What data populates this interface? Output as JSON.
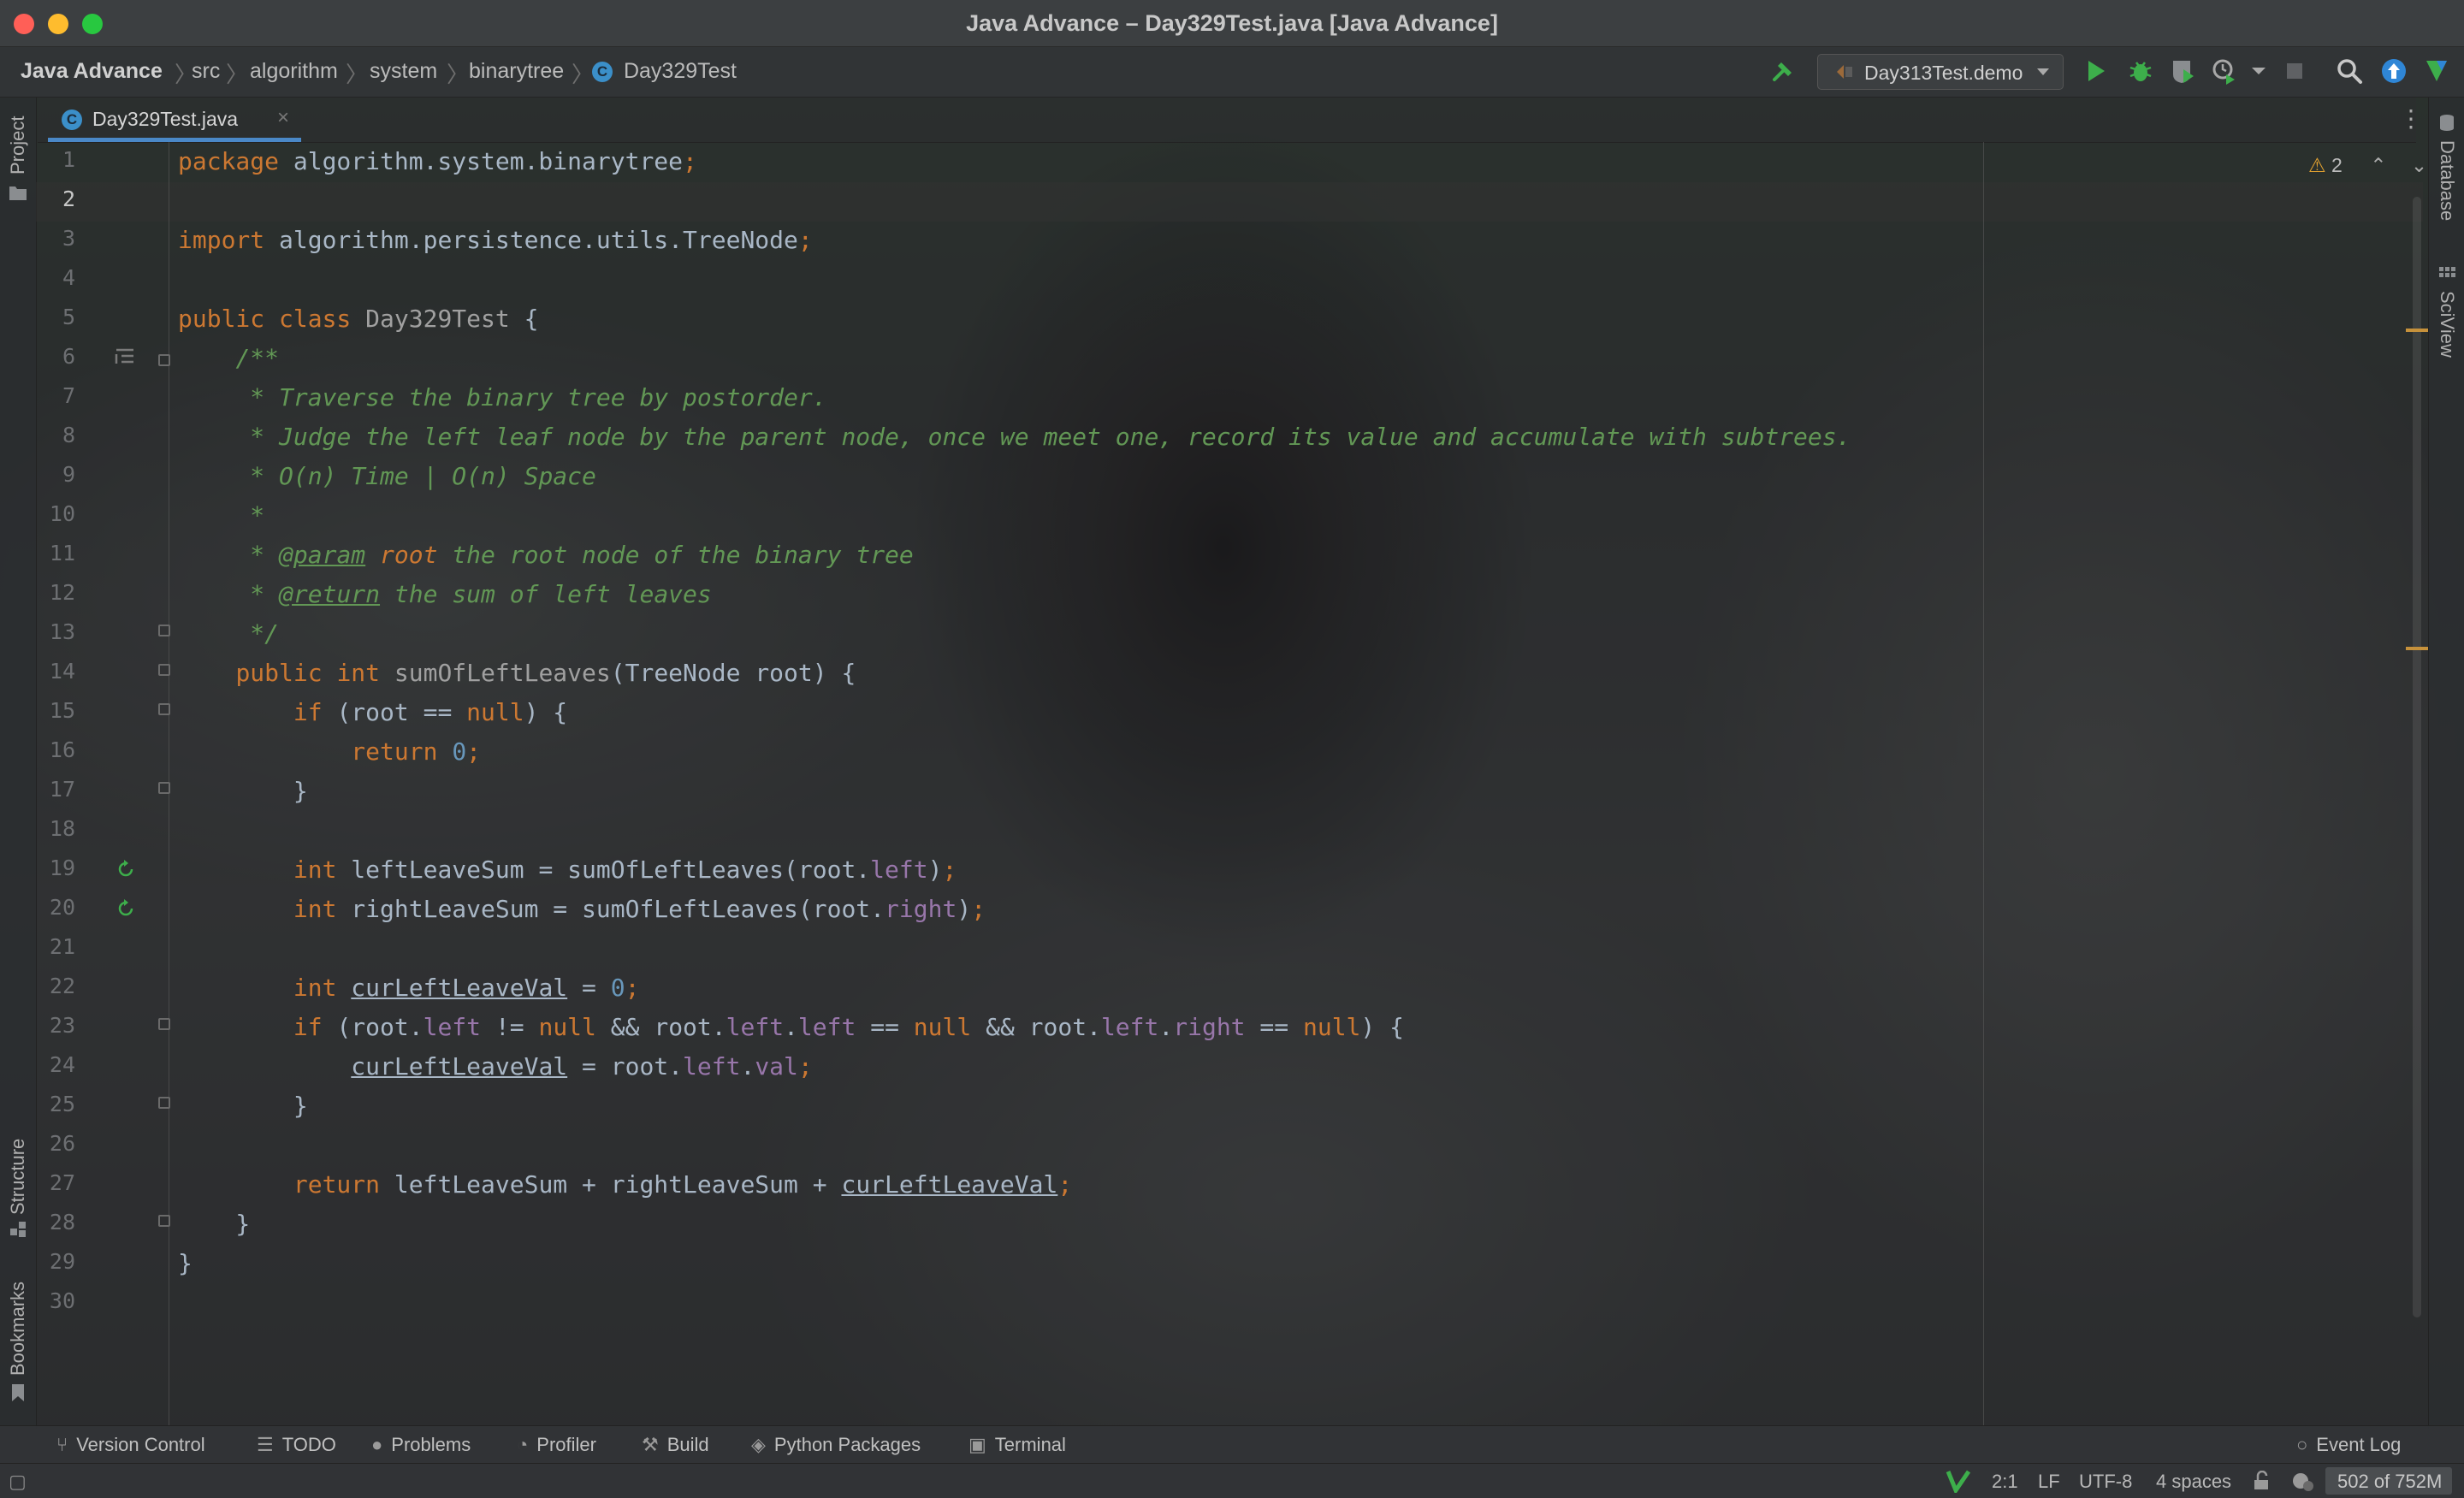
{
  "window": {
    "title": "Java Advance – Day329Test.java [Java Advance]"
  },
  "breadcrumb": {
    "project": "Java Advance",
    "items": [
      "src",
      "algorithm",
      "system",
      "binarytree"
    ],
    "class_icon": "C",
    "class_name": "Day329Test"
  },
  "toolbar": {
    "run_config": "Day313Test.demo",
    "icons": [
      "build-hammer-icon",
      "run-icon",
      "debug-icon",
      "coverage-icon",
      "profile-icon",
      "stop-icon",
      "search-icon",
      "update-icon",
      "plugin-icon"
    ]
  },
  "tabs": [
    {
      "label": "Day329Test.java",
      "icon": "C",
      "active": true
    }
  ],
  "left_strip": {
    "project": "Project",
    "structure": "Structure",
    "bookmarks": "Bookmarks"
  },
  "right_strip": {
    "database": "Database",
    "sciview": "SciView"
  },
  "editor": {
    "warnings_count": "2",
    "current_line": 2,
    "line_numbers": [
      "1",
      "2",
      "3",
      "4",
      "5",
      "6",
      "7",
      "8",
      "9",
      "10",
      "11",
      "12",
      "13",
      "14",
      "15",
      "16",
      "17",
      "18",
      "19",
      "20",
      "21",
      "22",
      "23",
      "24",
      "25",
      "26",
      "27",
      "28",
      "29",
      "30"
    ]
  },
  "bottom_tools": {
    "version_control": "Version Control",
    "todo": "TODO",
    "problems": "Problems",
    "profiler": "Profiler",
    "build": "Build",
    "python_packages": "Python Packages",
    "terminal": "Terminal",
    "event_log": "Event Log"
  },
  "status": {
    "position": "2:1",
    "line_sep": "LF",
    "encoding": "UTF-8",
    "indent": "4 spaces",
    "memory": "502 of 752M"
  },
  "colors": {
    "keyword": "#cc7832",
    "comment": "#629755",
    "number": "#6897bb",
    "field": "#9876aa",
    "text": "#a9b7c6",
    "tab_underline": "#4a88c7",
    "run_green": "#3dae4b"
  }
}
